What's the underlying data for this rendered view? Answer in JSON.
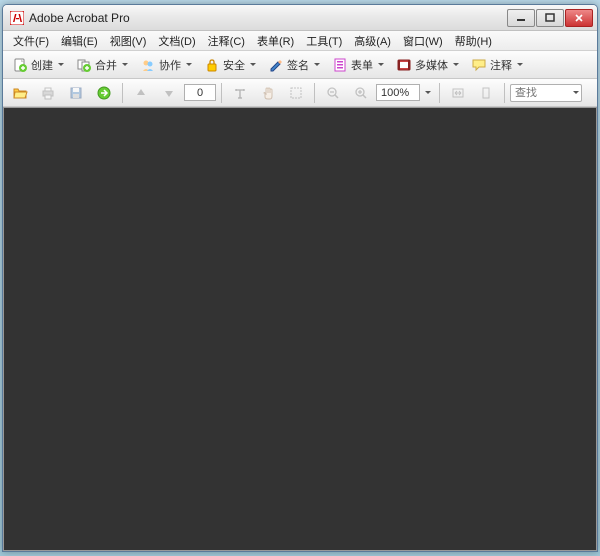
{
  "window": {
    "title": "Adobe Acrobat Pro"
  },
  "menu": {
    "file": "文件(F)",
    "edit": "编辑(E)",
    "view": "视图(V)",
    "document": "文档(D)",
    "comment": "注释(C)",
    "forms": "表单(R)",
    "tools": "工具(T)",
    "advanced": "高级(A)",
    "window": "窗口(W)",
    "help": "帮助(H)"
  },
  "toolbar1": {
    "create": "创建",
    "merge": "合并",
    "collab": "协作",
    "secure": "安全",
    "sign": "签名",
    "forms": "表单",
    "multimedia": "多媒体",
    "comments": "注释"
  },
  "toolbar2": {
    "page_num": "0",
    "zoom": "100%",
    "search_placeholder": "查找"
  }
}
